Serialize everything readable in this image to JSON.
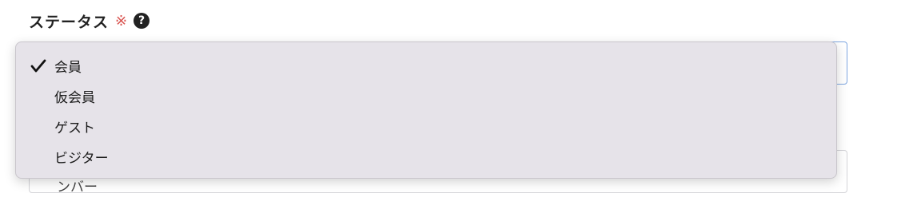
{
  "field": {
    "label": "ステータス",
    "required_mark": "※",
    "help_icon": "question-circle-icon",
    "help_glyph": "?"
  },
  "status_select": {
    "selected_value": "会員",
    "options": [
      {
        "label": "会員",
        "selected": true
      },
      {
        "label": "仮会員",
        "selected": false
      },
      {
        "label": "ゲスト",
        "selected": false
      },
      {
        "label": "ビジター",
        "selected": false
      }
    ]
  },
  "second_select": {
    "partial_text": "ンバー"
  },
  "colors": {
    "required": "#d9534f",
    "dropdown_bg": "#e6e3e9",
    "focus_border": "#7ea6e0"
  }
}
